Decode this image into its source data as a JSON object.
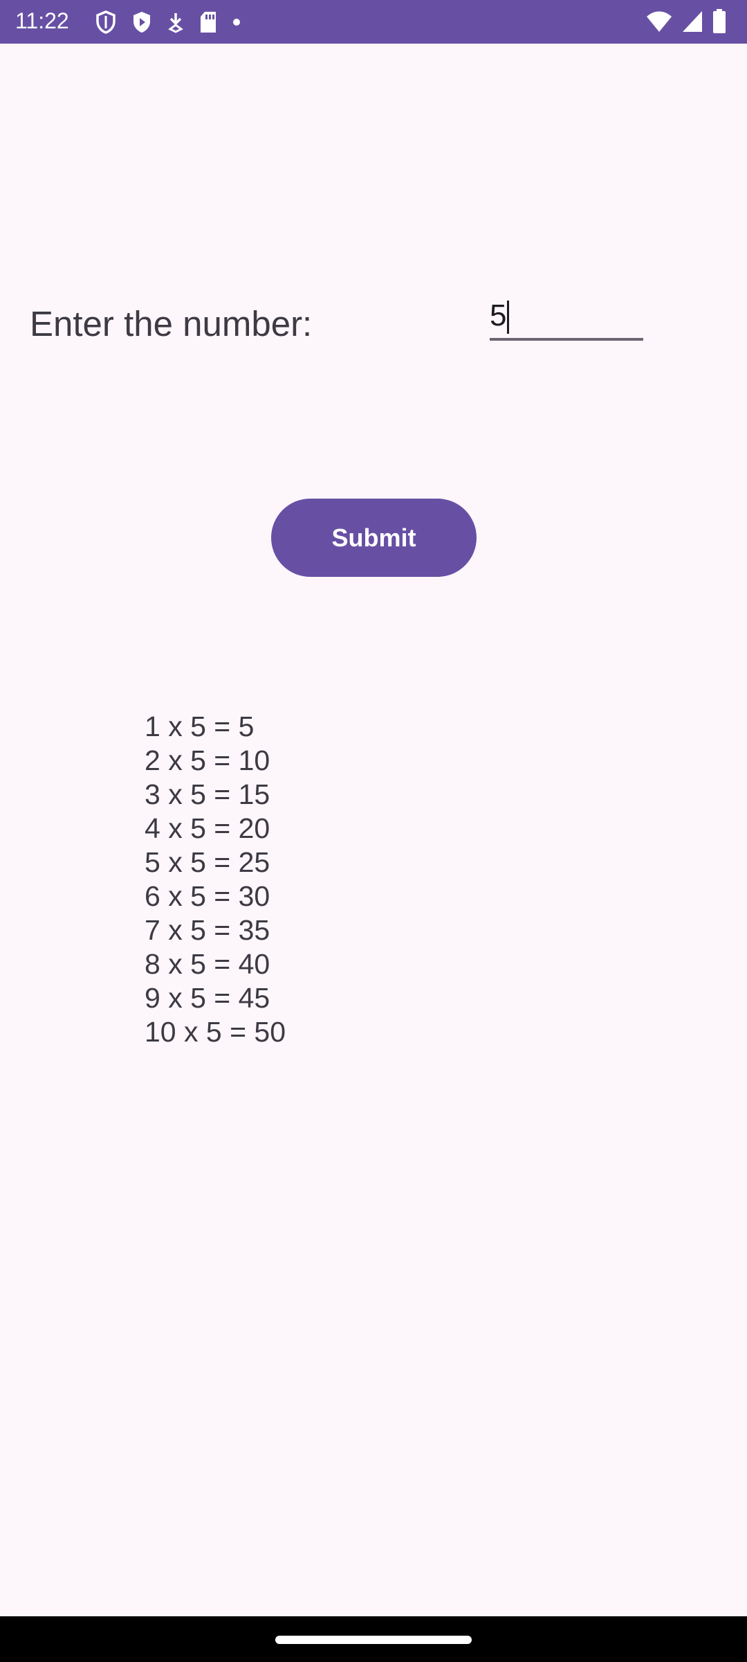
{
  "status_bar": {
    "time": "11:22",
    "left_icons": [
      "shield-icon",
      "play-shield-icon",
      "download-icon",
      "sd-card-icon",
      "dot-icon"
    ],
    "right_icons": [
      "wifi-icon",
      "signal-icon",
      "battery-icon"
    ],
    "color": "#6750a4"
  },
  "form": {
    "label": "Enter the number:",
    "input_value": "5",
    "submit_label": "Submit"
  },
  "table_rows": [
    "1 x 5 = 5",
    "2 x 5 = 10",
    "3 x 5 = 15",
    "4 x 5 = 20",
    "5 x 5 = 25",
    "6 x 5 = 30",
    "7 x 5 = 35",
    "8 x 5 = 40",
    "9 x 5 = 45",
    "10 x 5 = 50"
  ],
  "colors": {
    "accent": "#6750a4",
    "background": "#fdf7fc",
    "text": "#3d3a44"
  }
}
